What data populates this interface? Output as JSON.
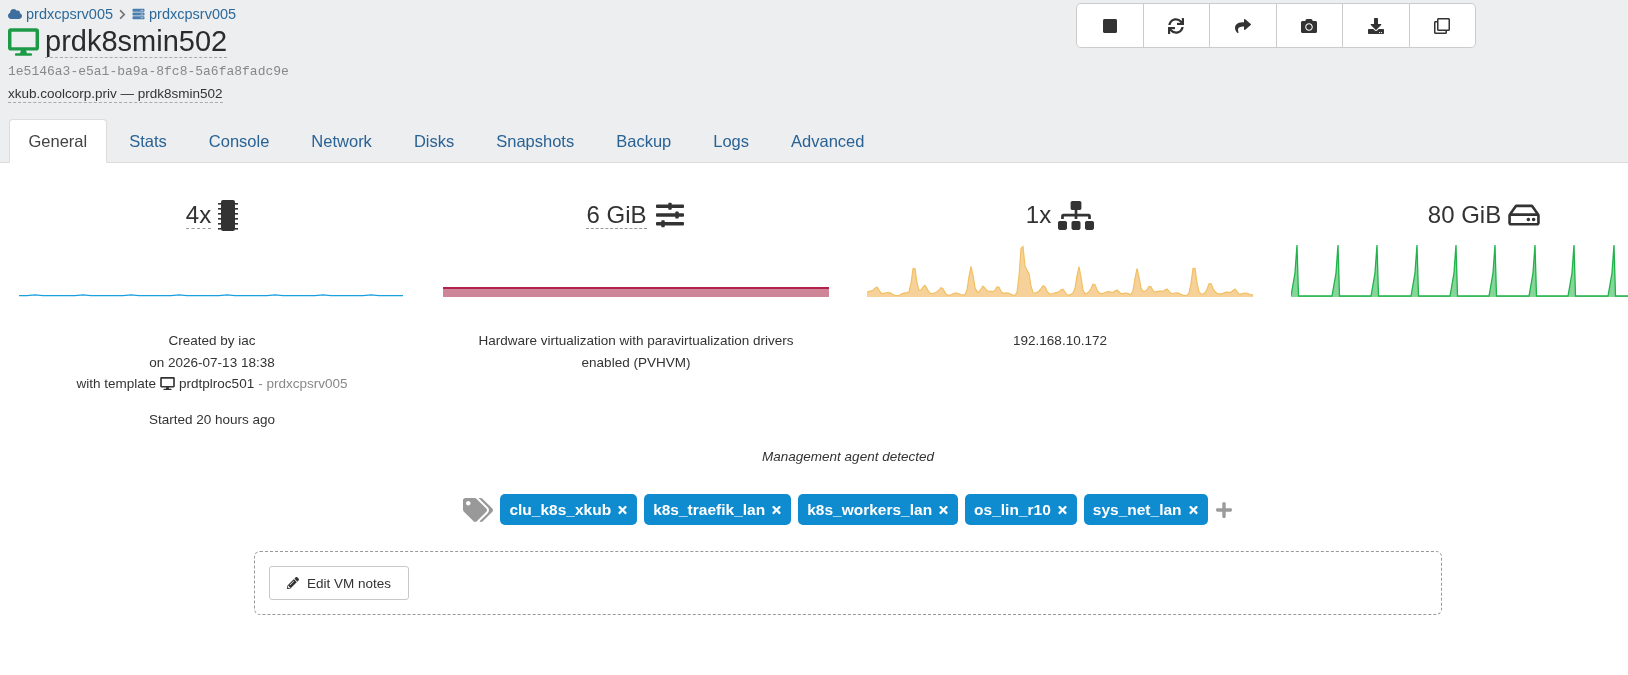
{
  "breadcrumb": [
    {
      "kind": "pool",
      "label": "prdxcpsrv005"
    },
    {
      "kind": "host",
      "label": "prdxcpsrv005"
    }
  ],
  "vm": {
    "name": "prdk8smin502",
    "running": true,
    "uuid": "1e5146a3-e5a1-ba9a-8fc8-5a6fa8fadc9e",
    "address": "xkub.coolcorp.priv — prdk8smin502"
  },
  "toolbar": [
    {
      "kind": "stop"
    },
    {
      "kind": "restart"
    },
    {
      "kind": "migrate"
    },
    {
      "kind": "snapshot"
    },
    {
      "kind": "export"
    },
    {
      "kind": "copy"
    }
  ],
  "tabs": [
    {
      "label": "General",
      "selected": true
    },
    {
      "label": "Stats",
      "selected": false
    },
    {
      "label": "Console",
      "selected": false
    },
    {
      "label": "Network",
      "selected": false
    },
    {
      "label": "Disks",
      "selected": false
    },
    {
      "label": "Snapshots",
      "selected": false
    },
    {
      "label": "Backup",
      "selected": false
    },
    {
      "label": "Logs",
      "selected": false
    },
    {
      "label": "Advanced",
      "selected": false
    }
  ],
  "stats": [
    {
      "kind": "cpu",
      "value": "4x",
      "editable": true
    },
    {
      "kind": "memory",
      "value": "6 GiB",
      "editable": true
    },
    {
      "kind": "network",
      "value": "1x",
      "editable": false
    },
    {
      "kind": "disk",
      "value": "80 GiB",
      "editable": false
    }
  ],
  "details": {
    "created_by": "Created by iac",
    "created_on": "on 2026-07-13 18:38",
    "template_label": "with template",
    "template": "prdtplroc501",
    "template_host": "- prdxcpsrv005",
    "started": "Started 20 hours ago",
    "virtualization": "Hardware virtualization with paravirtualization drivers enabled (PVHVM)",
    "ip_address": "192.168.10.172"
  },
  "agent_status": "Management agent detected",
  "tags": [
    "clu_k8s_xkub",
    "k8s_traefik_lan",
    "k8s_workers_lan",
    "os_lin_r10",
    "sys_net_lan"
  ],
  "notes": {
    "edit_button": "Edit VM notes"
  }
}
